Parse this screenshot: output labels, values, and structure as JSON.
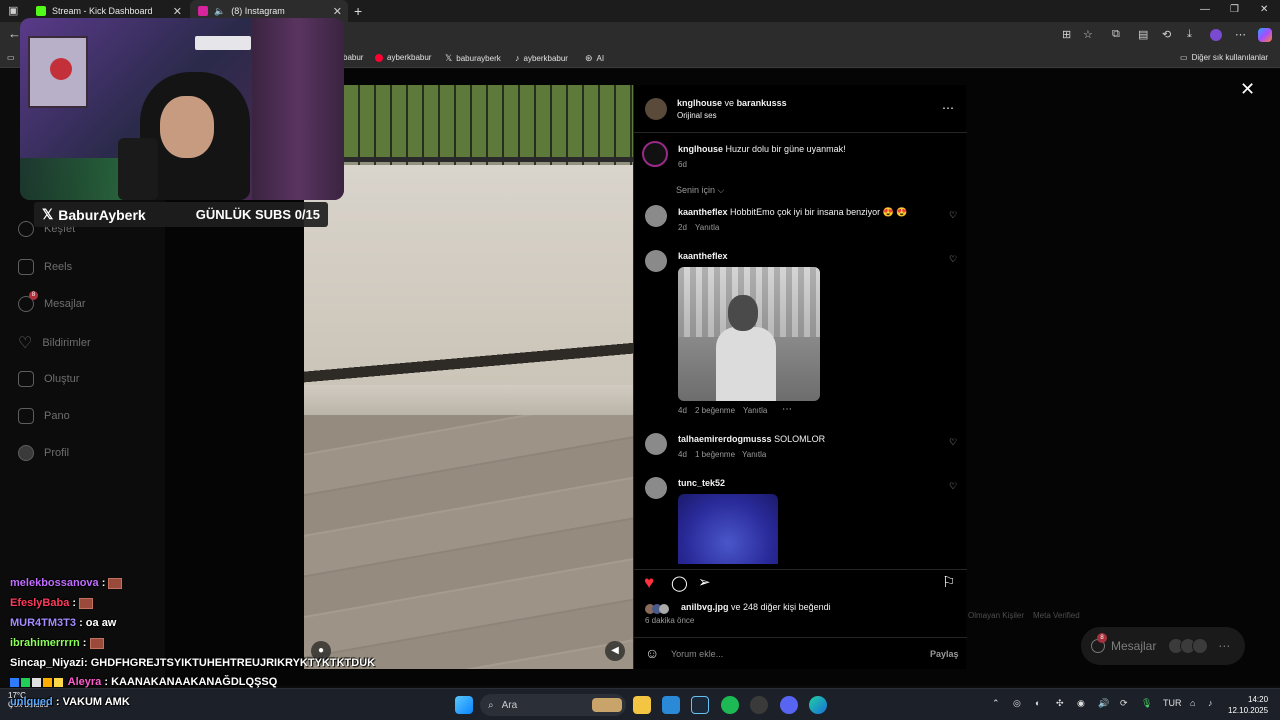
{
  "browser": {
    "tabs": [
      {
        "label": "Stream - Kick Dashboard",
        "color": "#53fc18"
      },
      {
        "label": "(8) Instagram",
        "color": "#d6249f"
      }
    ],
    "bookmarks": [
      "babur",
      "ayberkbabur",
      "baburayberk",
      "ayberkbabur",
      "AI"
    ],
    "other_bookmarks": "Diğer sık kullanılanlar"
  },
  "sidebar": {
    "items": [
      {
        "label": "Keşfet",
        "icon": "compass-icon"
      },
      {
        "label": "Reels",
        "icon": "reels-icon"
      },
      {
        "label": "Mesajlar",
        "icon": "messenger-icon",
        "badge": "8"
      },
      {
        "label": "Bildirimler",
        "icon": "heart-icon"
      },
      {
        "label": "Oluştur",
        "icon": "plus-icon"
      },
      {
        "label": "Pano",
        "icon": "chart-icon"
      },
      {
        "label": "Profil",
        "icon": "avatar-icon"
      }
    ]
  },
  "footer": {
    "links": [
      "Olmayan Kişiler",
      "Meta Verified"
    ]
  },
  "messages_pill": {
    "label": "Mesajlar",
    "badge": "8"
  },
  "post": {
    "header": {
      "user1": "knglhouse",
      "conj": "ve",
      "user2": "barankusss",
      "audio": "Orijinal ses"
    },
    "caption": {
      "user": "knglhouse",
      "text": "Huzur dolu bir güne uyanmak!",
      "time": "6d"
    },
    "sort_label": "Senin için",
    "comments": [
      {
        "user": "kaantheflex",
        "text": "HobbitEmo çok iyi bir insana benziyor 😍 😍",
        "time": "2d",
        "reply": "Yanıtla"
      },
      {
        "user": "kaantheflex",
        "text": "",
        "time": "4d",
        "likes": "2 beğenme",
        "reply": "Yanıtla"
      },
      {
        "user": "talhaemirerdogmusss",
        "text": "SOLOMLOR",
        "time": "4d",
        "likes": "1 beğenme",
        "reply": "Yanıtla"
      },
      {
        "user": "tunc_tek52",
        "text": ""
      }
    ],
    "liked_by": {
      "user": "anilbvg.jpg",
      "rest": "ve 248 diğer kişi beğendi",
      "time": "6 dakika önce"
    },
    "add_comment": {
      "placeholder": "Yorum ekle...",
      "share": "Paylaş"
    }
  },
  "stream": {
    "name": "BaburAyberk",
    "subs": "GÜNLÜK SUBS 0/15",
    "chat": [
      {
        "user": "melekbossanova",
        "color": "#c06cff",
        "msg": ":"
      },
      {
        "user": "EfeslyBaba",
        "color": "#ff3b5c",
        "msg": ":"
      },
      {
        "user": "MUR4TM3T3",
        "color": "#a58cff",
        "msg": ": oa aw"
      },
      {
        "user": "ibrahimerrrrn",
        "color": "#8dff5a",
        "msg": ":"
      },
      {
        "user": "Sincap_Niyazi",
        "color": "#ffffff",
        "msg": ": GHDFHGREJTSYIKTUHEHTREUJRIKRYKTYKTKTDUK"
      },
      {
        "user": "Aleyra",
        "color": "#ff5ccf",
        "msg": ": KAANAKANAAKANAĞDLQŞSQ"
      },
      {
        "user": "unlqued",
        "color": "#5aa9ff",
        "msg": ": VAKUM AMK"
      }
    ]
  },
  "taskbar": {
    "search": "Ara",
    "weather_temp": "17°C",
    "weather_desc": "Çok bulutlu",
    "lang": "TUR",
    "time": "14:20",
    "date": "12.10.2025"
  }
}
